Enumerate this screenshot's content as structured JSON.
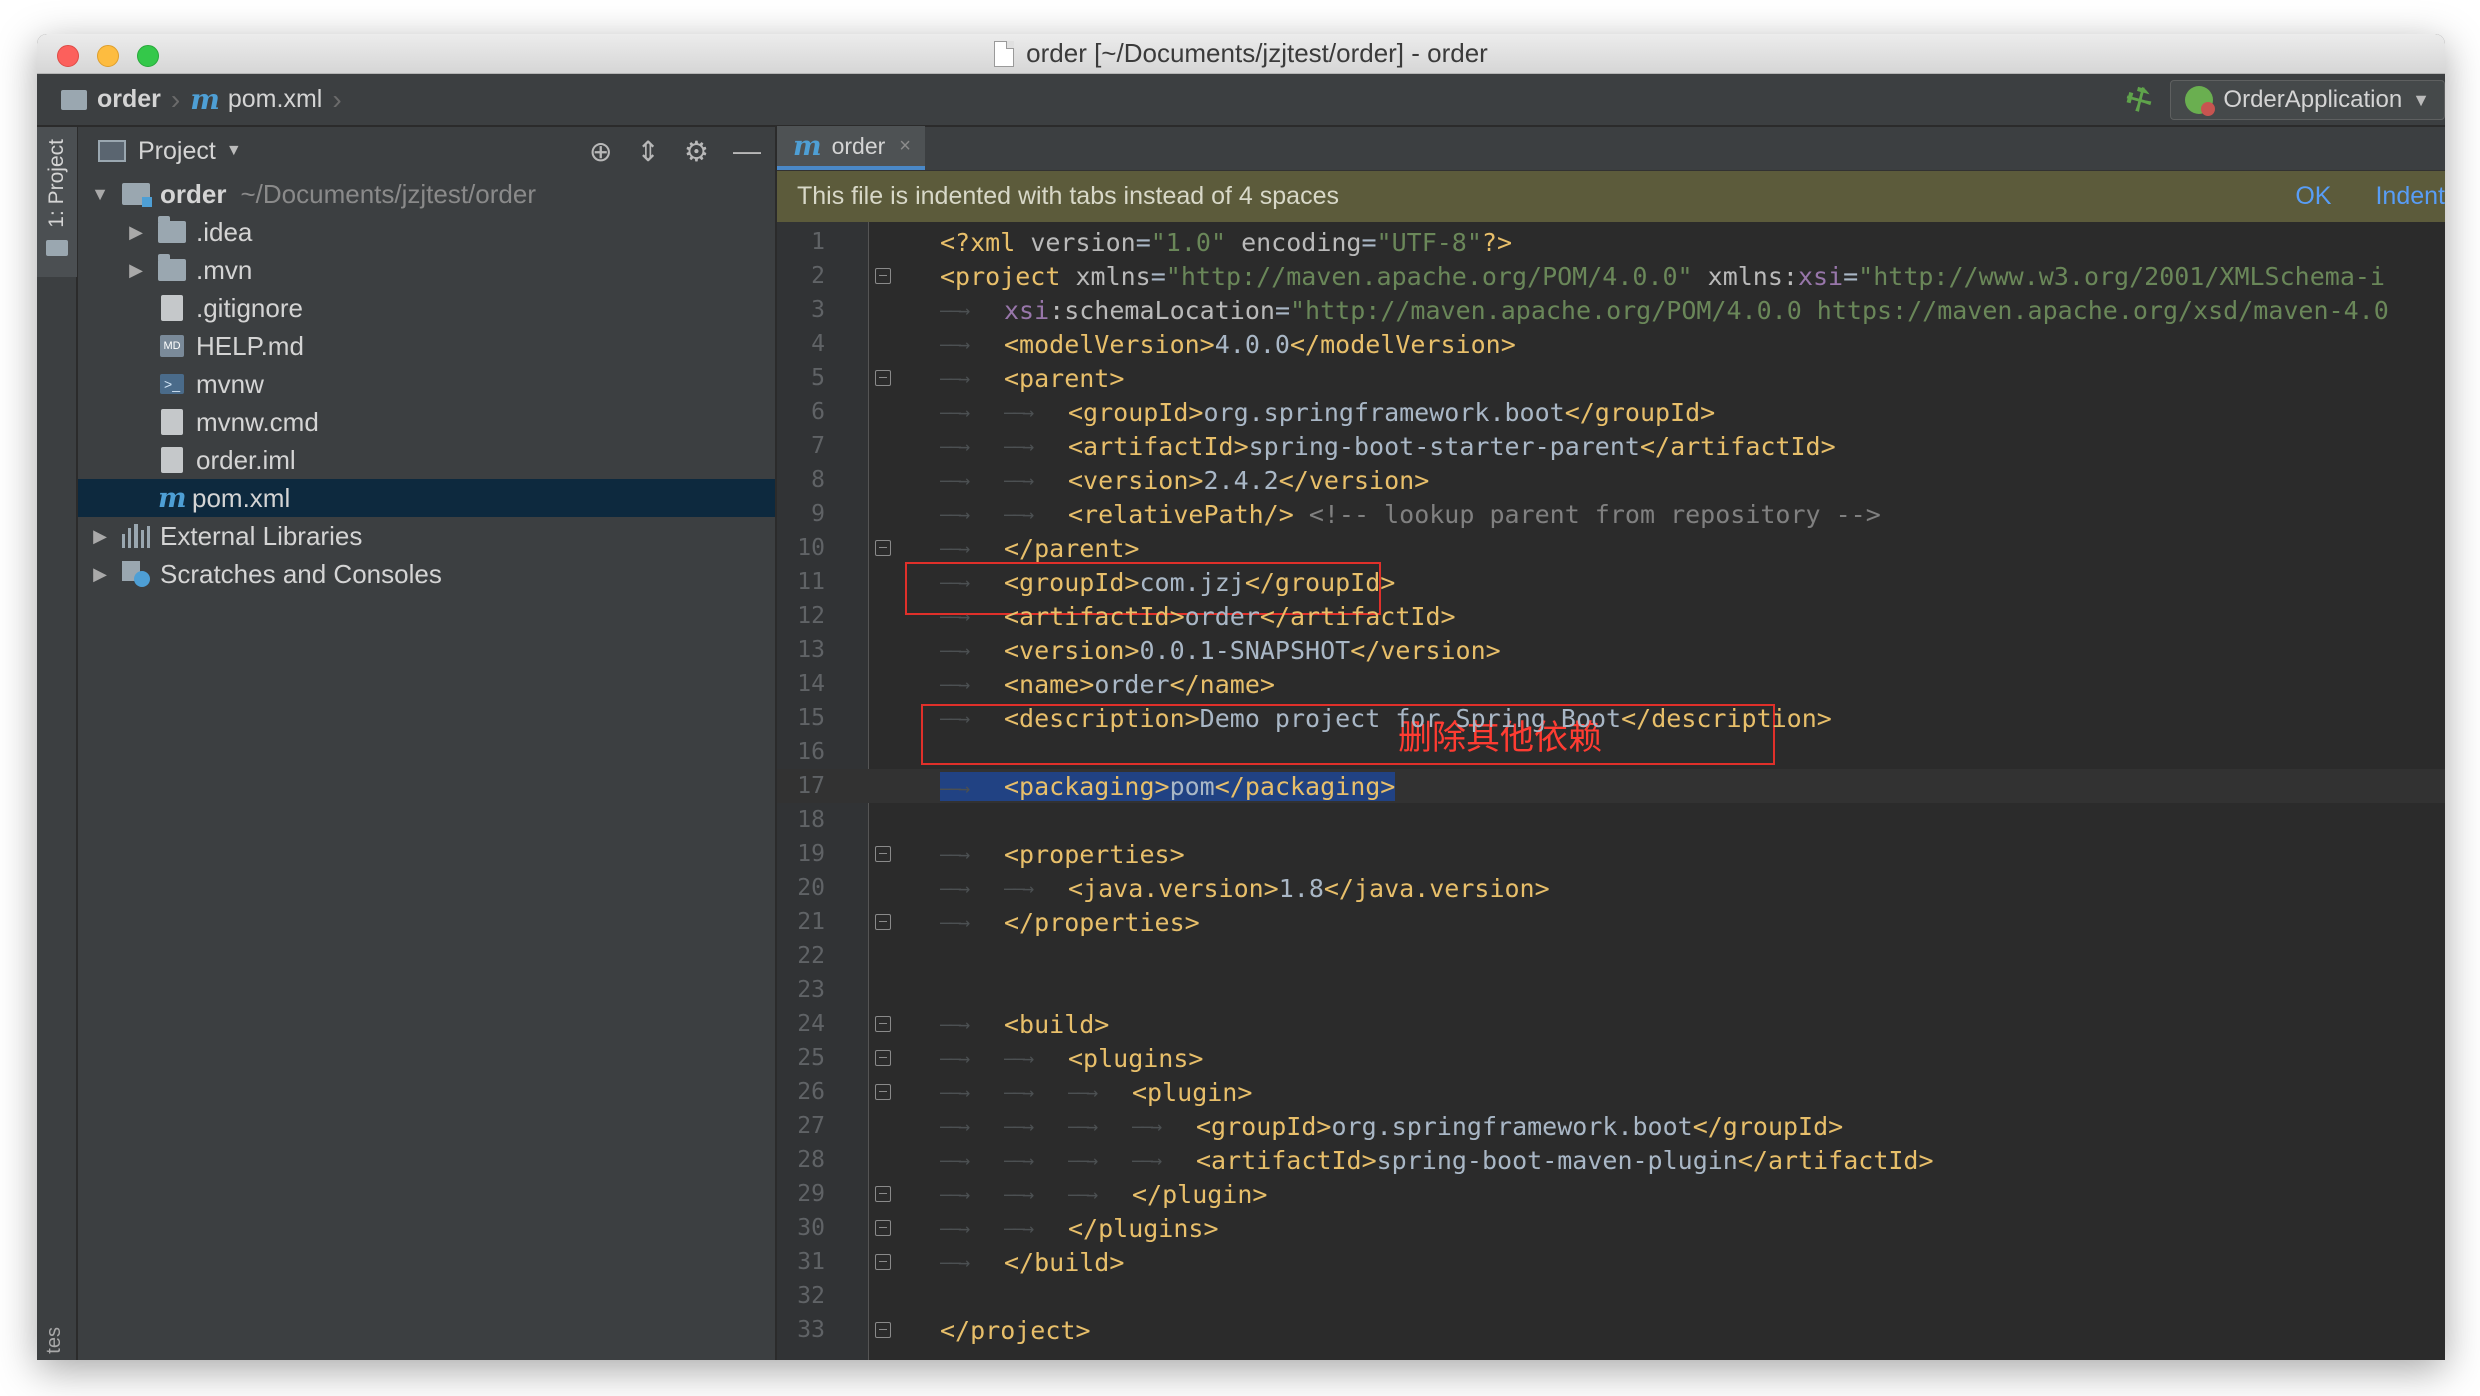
{
  "window": {
    "title": "order [~/Documents/jzjtest/order] - order"
  },
  "breadcrumb": {
    "project": "order",
    "file_glyph": "m",
    "file": "pom.xml"
  },
  "run_config": {
    "label": "OrderApplication",
    "icon": "spring-boot-run-icon"
  },
  "toolstrip": {
    "project_tab": "1: Project",
    "bottom_tab": "tes"
  },
  "project_panel": {
    "title": "Project",
    "tree": [
      {
        "label": "order",
        "extra": "~/Documents/jzjtest/order",
        "icon": "module-folder-icon",
        "depth": 0,
        "arrow": "▼"
      },
      {
        "label": ".idea",
        "icon": "folder-icon",
        "depth": 1,
        "arrow": "▶"
      },
      {
        "label": ".mvn",
        "icon": "folder-icon",
        "depth": 1,
        "arrow": "▶"
      },
      {
        "label": ".gitignore",
        "icon": "file-icon",
        "depth": 1
      },
      {
        "label": "HELP.md",
        "icon": "markdown-file-icon",
        "depth": 1
      },
      {
        "label": "mvnw",
        "icon": "shell-script-icon",
        "depth": 1
      },
      {
        "label": "mvnw.cmd",
        "icon": "file-icon",
        "depth": 1
      },
      {
        "label": "order.iml",
        "icon": "iml-file-icon",
        "depth": 1
      },
      {
        "label": "pom.xml",
        "icon": "maven-file-icon",
        "depth": 1,
        "selected": true
      },
      {
        "label": "External Libraries",
        "icon": "library-icon",
        "depth": 0,
        "arrow": "▶"
      },
      {
        "label": "Scratches and Consoles",
        "icon": "scratches-icon",
        "depth": 0,
        "arrow": "▶"
      }
    ]
  },
  "editor": {
    "tab": {
      "glyph": "m",
      "label": "order",
      "close": "×"
    },
    "notice": {
      "text": "This file is indented with tabs instead of 4 spaces",
      "ok": "OK",
      "indent": "Indent"
    },
    "annotation": {
      "text": "删除其他依赖",
      "color": "#ff3c32"
    },
    "lines": [
      {
        "n": "1",
        "tabs": 0,
        "parts": [
          [
            "pi",
            "<?xml"
          ],
          [
            "attr",
            " version"
          ],
          [
            "txt",
            "="
          ],
          [
            "str",
            "\"1.0\""
          ],
          [
            "attr",
            " encoding"
          ],
          [
            "txt",
            "="
          ],
          [
            "str",
            "\"UTF-8\""
          ],
          [
            "pi",
            "?>"
          ]
        ]
      },
      {
        "n": "2",
        "tabs": 0,
        "fold": true,
        "parts": [
          [
            "tag",
            "<project"
          ],
          [
            "attr",
            " xmlns"
          ],
          [
            "txt",
            "="
          ],
          [
            "str",
            "\"http://maven.apache.org/POM/4.0.0\""
          ],
          [
            "attr",
            " xmlns:"
          ],
          [
            "ns",
            "xsi"
          ],
          [
            "txt",
            "="
          ],
          [
            "str",
            "\"http://www.w3.org/2001/XMLSchema-i"
          ]
        ]
      },
      {
        "n": "3",
        "tabs": 1,
        "parts": [
          [
            "ns",
            "xsi"
          ],
          [
            "attr",
            ":schemaLocation"
          ],
          [
            "txt",
            "="
          ],
          [
            "str",
            "\"http://maven.apache.org/POM/4.0.0 https://maven.apache.org/xsd/maven-4.0"
          ]
        ]
      },
      {
        "n": "4",
        "tabs": 1,
        "parts": [
          [
            "tag",
            "<modelVersion>"
          ],
          [
            "txt",
            "4.0.0"
          ],
          [
            "tag",
            "</modelVersion>"
          ]
        ]
      },
      {
        "n": "5",
        "tabs": 1,
        "fold": true,
        "parts": [
          [
            "tag",
            "<parent>"
          ]
        ]
      },
      {
        "n": "6",
        "tabs": 2,
        "parts": [
          [
            "tag",
            "<groupId>"
          ],
          [
            "txt",
            "org.springframework.boot"
          ],
          [
            "tag",
            "</groupId>"
          ]
        ]
      },
      {
        "n": "7",
        "tabs": 2,
        "parts": [
          [
            "tag",
            "<artifactId>"
          ],
          [
            "txt",
            "spring-boot-starter-parent"
          ],
          [
            "tag",
            "</artifactId>"
          ]
        ]
      },
      {
        "n": "8",
        "tabs": 2,
        "parts": [
          [
            "tag",
            "<version>"
          ],
          [
            "txt",
            "2.4.2"
          ],
          [
            "tag",
            "</version>"
          ]
        ]
      },
      {
        "n": "9",
        "tabs": 2,
        "parts": [
          [
            "tag",
            "<relativePath/>"
          ],
          [
            "cmt",
            " <!-- lookup parent from repository -->"
          ]
        ]
      },
      {
        "n": "10",
        "tabs": 1,
        "fold": true,
        "parts": [
          [
            "tag",
            "</parent>"
          ]
        ]
      },
      {
        "n": "11",
        "tabs": 1,
        "parts": [
          [
            "tag",
            "<groupId>"
          ],
          [
            "txt",
            "com.jzj"
          ],
          [
            "tag",
            "</groupId>"
          ]
        ]
      },
      {
        "n": "12",
        "tabs": 1,
        "parts": [
          [
            "tag",
            "<artifactId>"
          ],
          [
            "txt",
            "order"
          ],
          [
            "tag",
            "</artifactId>"
          ]
        ]
      },
      {
        "n": "13",
        "tabs": 1,
        "parts": [
          [
            "tag",
            "<version>"
          ],
          [
            "txt",
            "0.0.1-SNAPSHOT"
          ],
          [
            "tag",
            "</version>"
          ]
        ]
      },
      {
        "n": "14",
        "tabs": 1,
        "parts": [
          [
            "tag",
            "<name>"
          ],
          [
            "txt",
            "order"
          ],
          [
            "tag",
            "</name>"
          ]
        ]
      },
      {
        "n": "15",
        "tabs": 1,
        "parts": [
          [
            "tag",
            "<description>"
          ],
          [
            "txt",
            "Demo project for Spring Boot"
          ],
          [
            "tag",
            "</description>"
          ]
        ]
      },
      {
        "n": "16",
        "tabs": 0,
        "parts": []
      },
      {
        "n": "17",
        "tabs": 1,
        "current": true,
        "selected": true,
        "parts": [
          [
            "tag",
            "<packaging>"
          ],
          [
            "txt",
            "pom"
          ],
          [
            "tag",
            "</packaging>"
          ]
        ]
      },
      {
        "n": "18",
        "tabs": 0,
        "parts": []
      },
      {
        "n": "19",
        "tabs": 1,
        "fold": true,
        "parts": [
          [
            "tag",
            "<properties>"
          ]
        ]
      },
      {
        "n": "20",
        "tabs": 2,
        "parts": [
          [
            "tag",
            "<java.version>"
          ],
          [
            "txt",
            "1.8"
          ],
          [
            "tag",
            "</java.version>"
          ]
        ]
      },
      {
        "n": "21",
        "tabs": 1,
        "fold": true,
        "parts": [
          [
            "tag",
            "</properties>"
          ]
        ]
      },
      {
        "n": "22",
        "tabs": 0,
        "parts": []
      },
      {
        "n": "23",
        "tabs": 0,
        "parts": []
      },
      {
        "n": "24",
        "tabs": 1,
        "fold": true,
        "parts": [
          [
            "tag",
            "<build>"
          ]
        ]
      },
      {
        "n": "25",
        "tabs": 2,
        "fold": true,
        "parts": [
          [
            "tag",
            "<plugins>"
          ]
        ]
      },
      {
        "n": "26",
        "tabs": 3,
        "fold": true,
        "parts": [
          [
            "tag",
            "<plugin>"
          ]
        ]
      },
      {
        "n": "27",
        "tabs": 4,
        "parts": [
          [
            "tag",
            "<groupId>"
          ],
          [
            "txt",
            "org.springframework.boot"
          ],
          [
            "tag",
            "</groupId>"
          ]
        ]
      },
      {
        "n": "28",
        "tabs": 4,
        "parts": [
          [
            "tag",
            "<artifactId>"
          ],
          [
            "txt",
            "spring-boot-maven-plugin"
          ],
          [
            "tag",
            "</artifactId>"
          ]
        ]
      },
      {
        "n": "29",
        "tabs": 3,
        "fold": true,
        "parts": [
          [
            "tag",
            "</plugin>"
          ]
        ]
      },
      {
        "n": "30",
        "tabs": 2,
        "fold": true,
        "parts": [
          [
            "tag",
            "</plugins>"
          ]
        ]
      },
      {
        "n": "31",
        "tabs": 1,
        "fold": true,
        "parts": [
          [
            "tag",
            "</build>"
          ]
        ]
      },
      {
        "n": "32",
        "tabs": 0,
        "parts": []
      },
      {
        "n": "33",
        "tabs": 0,
        "fold": true,
        "parts": [
          [
            "tag",
            "</project>"
          ]
        ]
      }
    ]
  }
}
